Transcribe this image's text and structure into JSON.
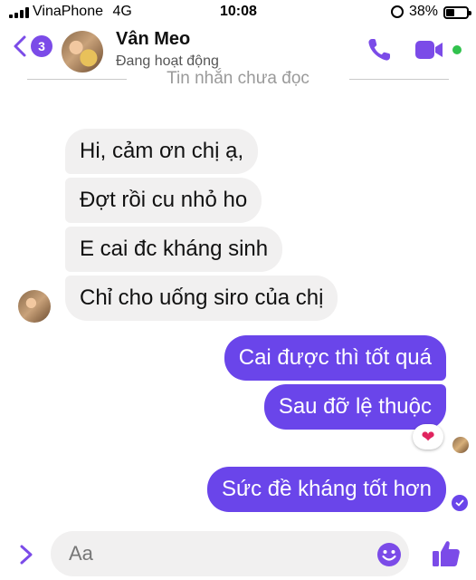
{
  "status_bar": {
    "carrier": "VinaPhone",
    "network": "4G",
    "time": "10:08",
    "battery": "38%"
  },
  "header": {
    "back_badge_count": "3",
    "contact_name": "Vân Meo",
    "presence": "Đang hoạt động",
    "accent_color": "#7b4be8",
    "online_color": "#31c24d"
  },
  "divider": {
    "label": "Tin nhắn chưa đọc"
  },
  "messages": {
    "incoming": [
      "Hi, cảm ơn chị ạ,",
      "Đợt rồi cu nhỏ ho",
      "E cai đc kháng sinh",
      "Chỉ cho uống siro của chị"
    ],
    "outgoing": [
      "Cai được thì tốt quá",
      "Sau đỡ lệ thuộc",
      "Sức đề kháng tốt hơn"
    ],
    "reaction": "❤",
    "outgoing_color": "#6a45ea",
    "incoming_color": "#f1f0f0"
  },
  "composer": {
    "placeholder": "Aa"
  }
}
